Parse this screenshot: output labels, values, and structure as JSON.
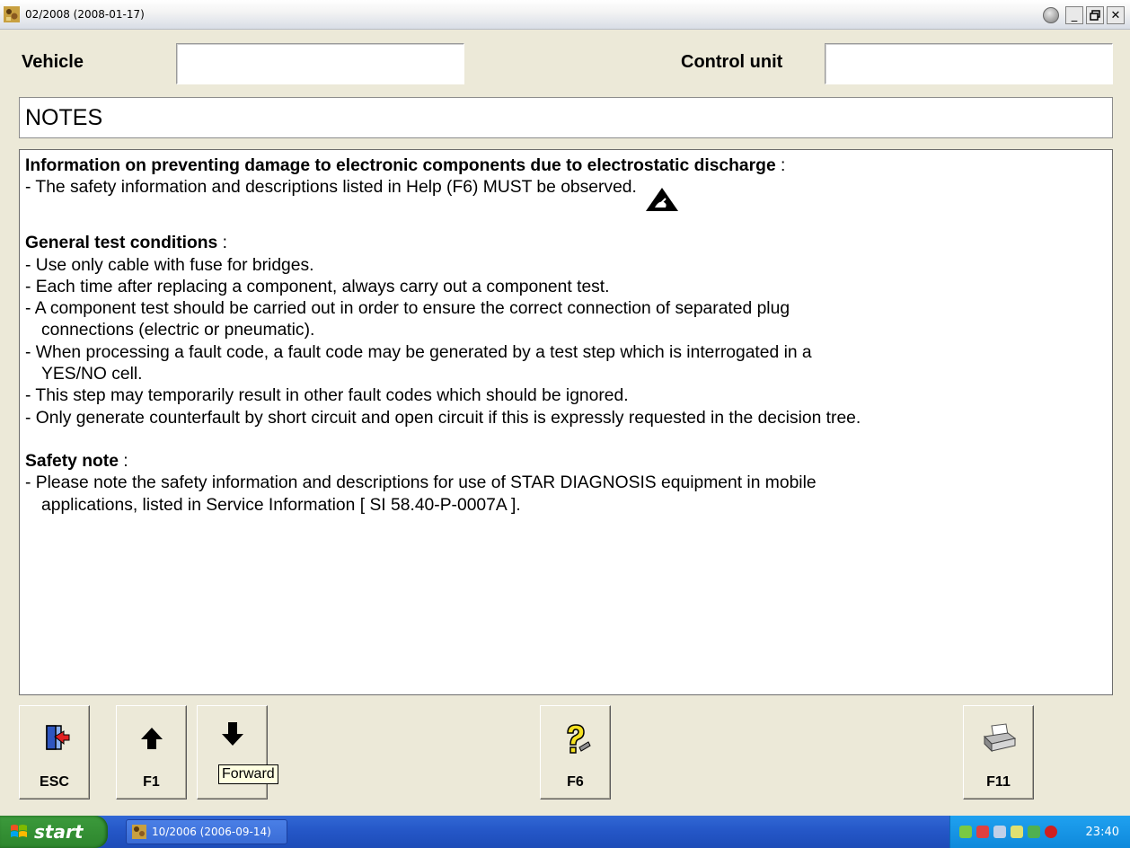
{
  "window": {
    "title": "02/2008 (2008-01-17)",
    "minimize": "_",
    "restore": "🗗",
    "close": "✕"
  },
  "header": {
    "vehicle_label": "Vehicle",
    "vehicle_value": "",
    "control_unit_label": "Control unit",
    "control_unit_value": ""
  },
  "section_title": "NOTES",
  "content": {
    "esd_heading": "Information on preventing damage to electronic components due to electrostatic discharge",
    "esd_heading_suffix": " :",
    "esd_line": "- The safety information and descriptions listed in Help (F6) MUST be observed.",
    "general_heading": "General test conditions",
    "general_heading_suffix": " :",
    "general_lines": [
      "- Use only cable with fuse for bridges.",
      "- Each time after replacing a component, always carry out a component test.",
      "- A component test should be carried out in order to ensure the correct connection of separated plug",
      "connections (electric or pneumatic).",
      "- When processing a fault code, a fault code may be generated by a test step which is interrogated in a",
      "YES/NO cell.",
      "- This step may temporarily result in other fault codes which should be ignored.",
      "- Only generate counterfault by short circuit and open circuit if this is expressly requested in the decision tree."
    ],
    "safety_heading": "Safety note",
    "safety_heading_suffix": " :",
    "safety_lines": [
      "- Please note the safety information and descriptions for use of STAR DIAGNOSIS equipment in mobile",
      "applications, listed in Service Information [ SI 58.40-P-0007A ]."
    ]
  },
  "buttons": {
    "esc": "ESC",
    "f1": "F1",
    "f2_tooltip": "Forward",
    "f6": "F6",
    "f11": "F11"
  },
  "taskbar": {
    "start": "start",
    "task": "10/2006 (2006-09-14)",
    "clock": "23:40"
  }
}
